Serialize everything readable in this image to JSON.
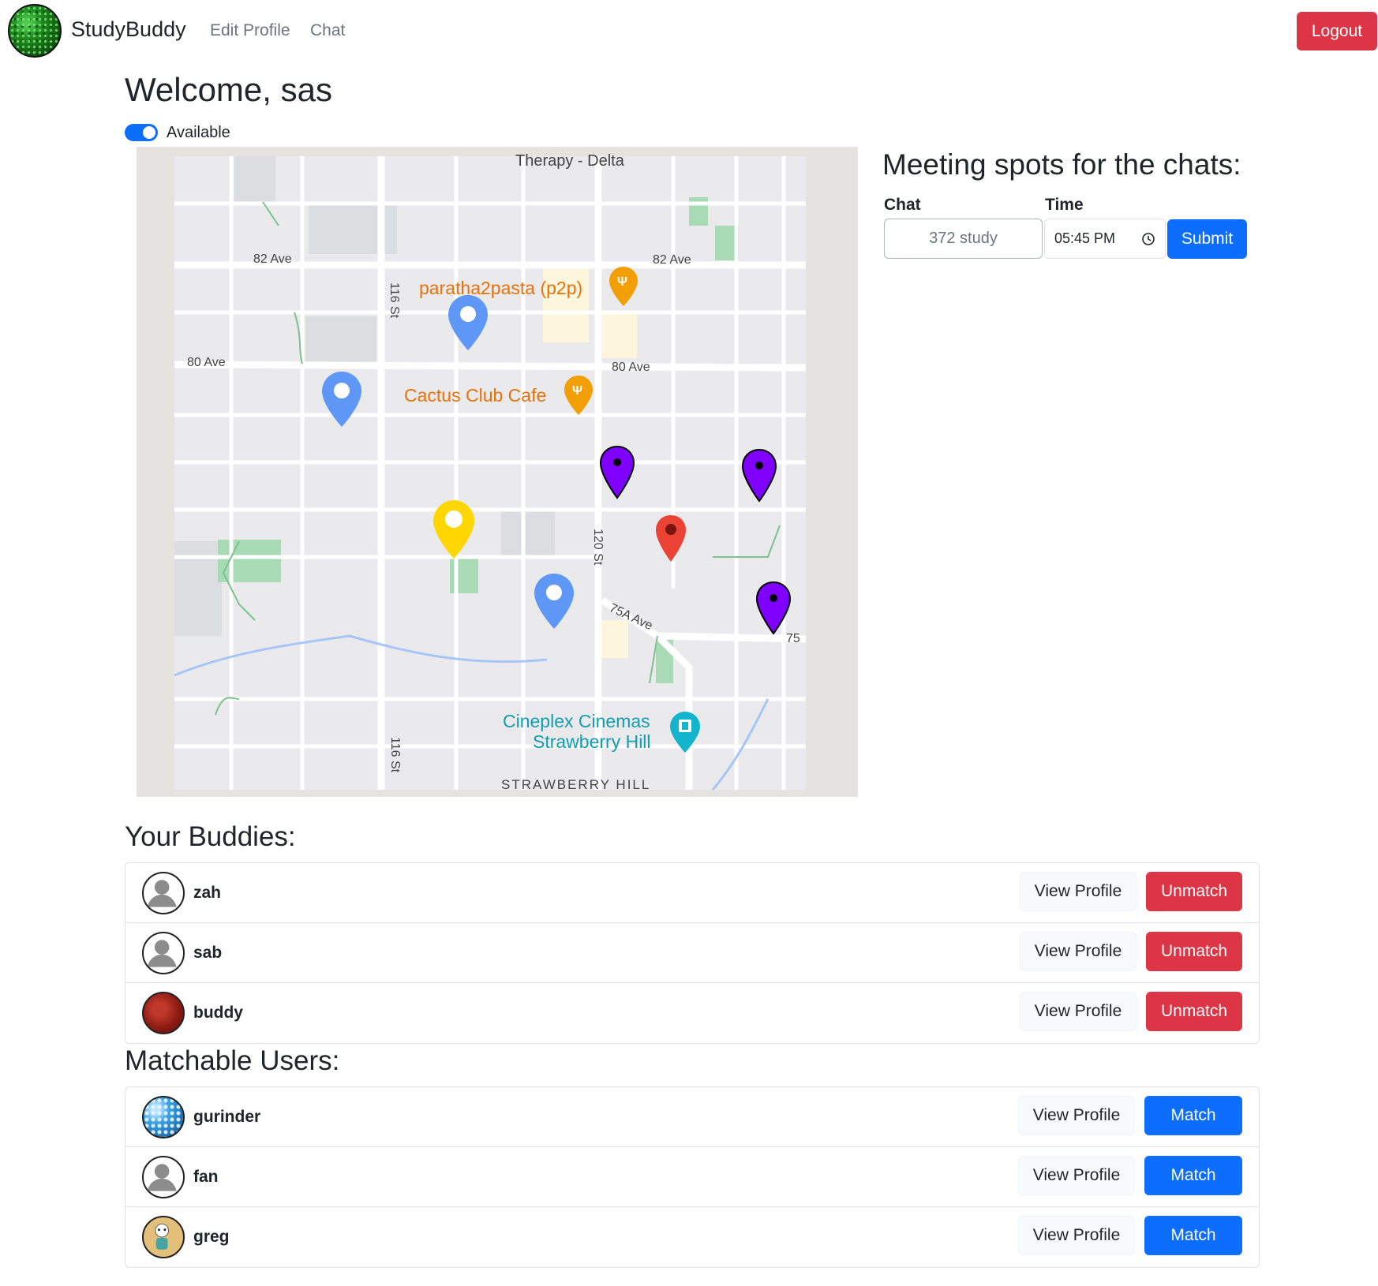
{
  "nav": {
    "brand": "StudyBuddy",
    "links": [
      "Edit Profile",
      "Chat"
    ],
    "logout": "Logout"
  },
  "welcome": "Welcome, sas",
  "availability": {
    "label": "Available",
    "on": true
  },
  "map": {
    "labels": {
      "top": "Therapy - Delta",
      "ave82_left": "82 Ave",
      "ave82_right": "82 Ave",
      "ave80_left": "80 Ave",
      "ave80_right": "80 Ave",
      "st116_top": "116 St",
      "st116_bottom": "116 St",
      "st120": "120 St",
      "ave75a": "75A Ave",
      "ave75": "75",
      "strawberry": "STRAWBERRY HILL"
    },
    "places": {
      "paratha": "paratha2pasta (p2p)",
      "cactus": "Cactus Club Cafe",
      "cineplex1": "Cineplex Cinemas",
      "cineplex2": "Strawberry Hill"
    },
    "marker_colors": {
      "blue": "#5e97f6",
      "purple": "#7f00ff",
      "red": "#ea4335",
      "yellow": "#ffd600",
      "food": "#f29f05",
      "cinema": "#12b5cb"
    }
  },
  "meeting": {
    "title": "Meeting spots for the chats:",
    "chat_label": "Chat",
    "time_label": "Time",
    "chat_value": "372 study",
    "time_value": "05:45  PM",
    "submit": "Submit"
  },
  "buddies": {
    "title": "Your Buddies:",
    "items": [
      {
        "name": "zah",
        "view": "View Profile",
        "action": "Unmatch"
      },
      {
        "name": "sab",
        "view": "View Profile",
        "action": "Unmatch"
      },
      {
        "name": "buddy",
        "view": "View Profile",
        "action": "Unmatch"
      }
    ]
  },
  "matchable": {
    "title": "Matchable Users:",
    "items": [
      {
        "name": "gurinder",
        "view": "View Profile",
        "action": "Match"
      },
      {
        "name": "fan",
        "view": "View Profile",
        "action": "Match"
      },
      {
        "name": "greg",
        "view": "View Profile",
        "action": "Match"
      }
    ]
  }
}
